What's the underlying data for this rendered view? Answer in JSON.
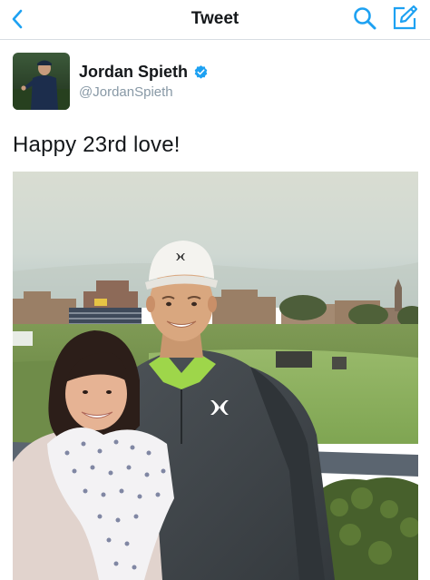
{
  "nav": {
    "title": "Tweet",
    "back_icon": "chevron-left-icon",
    "search_icon": "search-icon",
    "compose_icon": "compose-icon",
    "accent_color": "#1da1f2"
  },
  "tweet": {
    "author_name": "Jordan Spieth",
    "author_handle": "@JordanSpieth",
    "verified": true,
    "text": "Happy 23rd love!",
    "verified_color": "#1da1f2"
  }
}
